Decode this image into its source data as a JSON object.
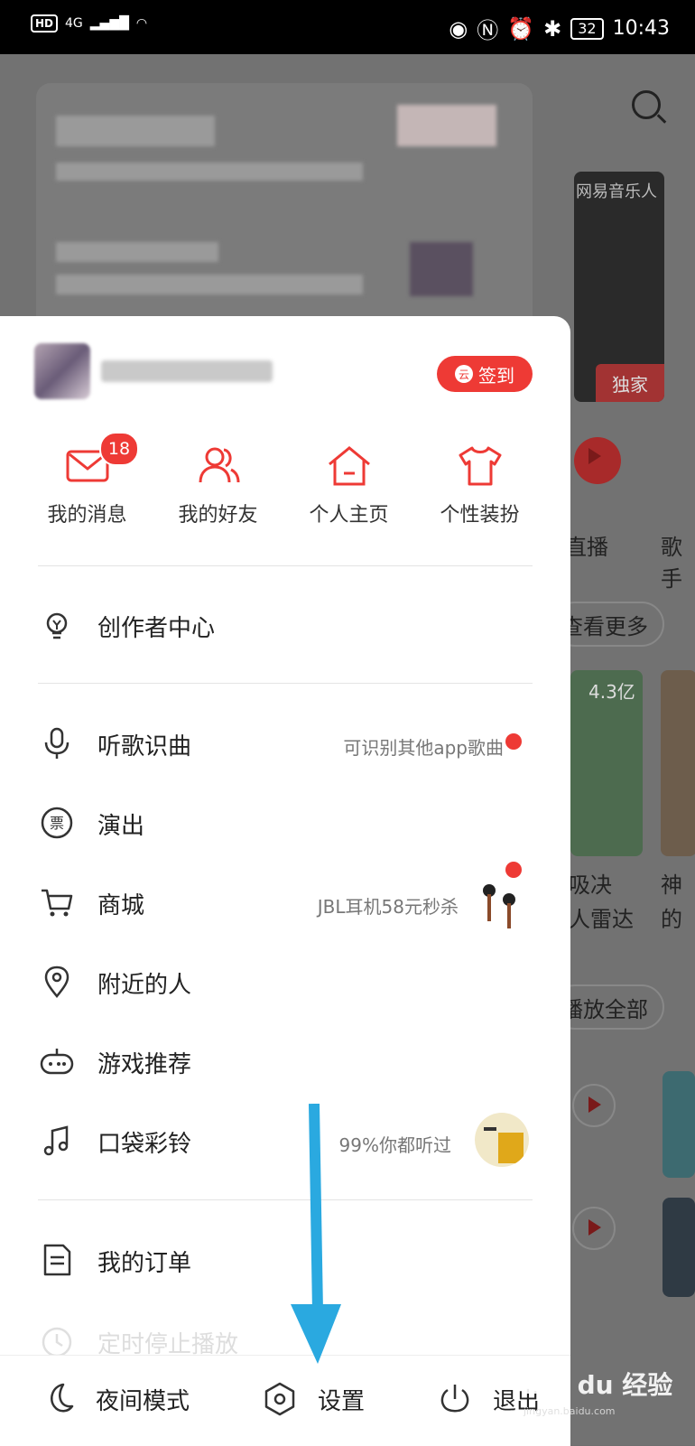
{
  "status_bar": {
    "hd": "HD",
    "network": "4G",
    "battery": "32",
    "time": "10:43"
  },
  "background": {
    "album_label": "网易音乐人",
    "album_tag": "独家",
    "live_label": "直播",
    "singer_label": "歌手",
    "see_more": "查看更多",
    "play_count": "4.3亿",
    "card_title_1": "吸决",
    "card_title_2": "人雷达",
    "card_title_3": "神",
    "card_title_4": "的",
    "play_all": "播放全部"
  },
  "drawer": {
    "signin_label": "签到",
    "quick_actions": [
      {
        "label": "我的消息",
        "badge": "18"
      },
      {
        "label": "我的好友"
      },
      {
        "label": "个人主页"
      },
      {
        "label": "个性装扮"
      }
    ],
    "creator_center": "创作者中心",
    "menu": [
      {
        "label": "听歌识曲",
        "hint": "可识别其他app歌曲"
      },
      {
        "label": "演出"
      },
      {
        "label": "商城",
        "hint": "JBL耳机58元秒杀"
      },
      {
        "label": "附近的人"
      },
      {
        "label": "游戏推荐"
      },
      {
        "label": "口袋彩铃",
        "hint": "99%你都听过"
      }
    ],
    "my_orders": "我的订单",
    "timer_stop": "定时停止播放",
    "bottom": {
      "night_mode": "夜间模式",
      "settings": "设置",
      "logout": "退出"
    }
  },
  "watermark": {
    "brand": "Bai du 经验",
    "url": "jingyan.baidu.com"
  },
  "colors": {
    "accent": "#ee3a35",
    "arrow": "#2aa9e0",
    "text": "#222222"
  },
  "icons": [
    "mail-icon",
    "friends-icon",
    "home-icon",
    "tshirt-icon",
    "lightbulb-icon",
    "mic-icon",
    "ticket-icon",
    "cart-icon",
    "location-icon",
    "gamepad-icon",
    "music-note-icon",
    "document-icon",
    "moon-icon",
    "settings-icon",
    "power-icon"
  ]
}
